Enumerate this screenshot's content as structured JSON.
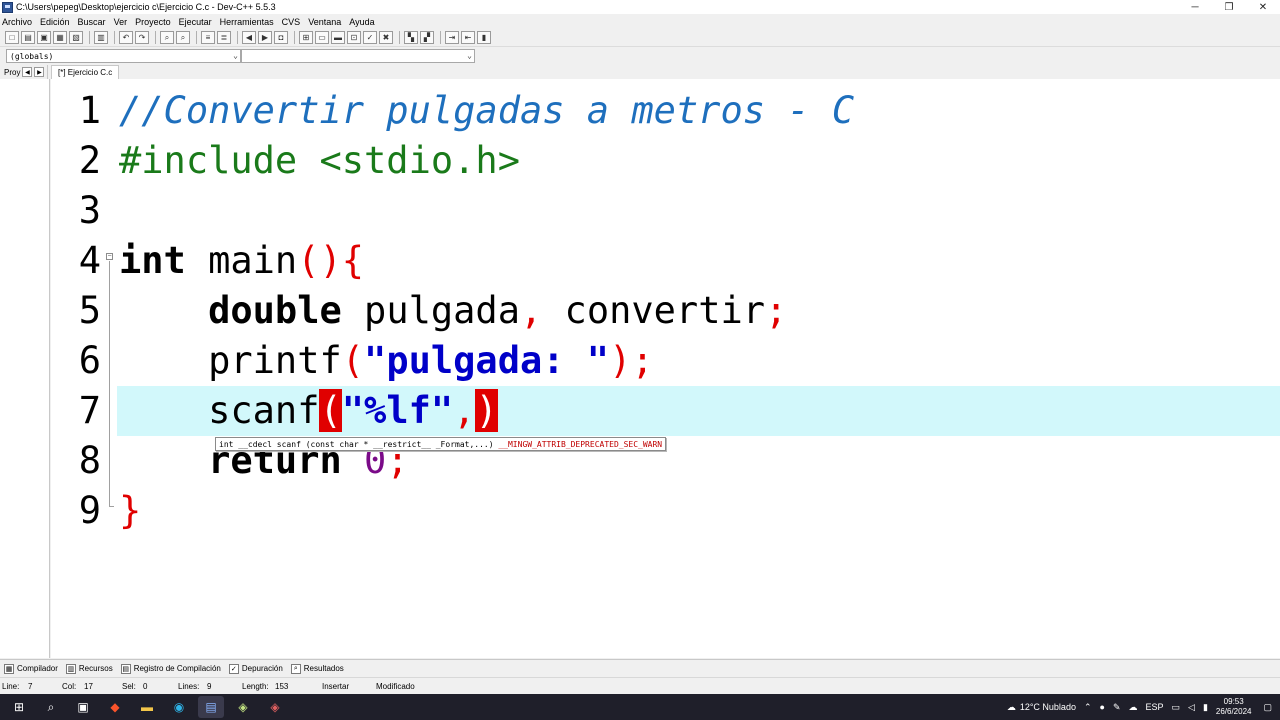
{
  "window": {
    "title": "C:\\Users\\pepeg\\Desktop\\ejercicio c\\Ejercicio C.c - Dev-C++ 5.5.3",
    "min_glyph": "─",
    "restore_glyph": "❐",
    "close_glyph": "✕"
  },
  "menu": [
    "Archivo",
    "Edición",
    "Buscar",
    "Ver",
    "Proyecto",
    "Ejecutar",
    "Herramientas",
    "CVS",
    "Ventana",
    "Ayuda"
  ],
  "scope_combo": {
    "value": "(globals)"
  },
  "member_combo": {
    "value": ""
  },
  "project_tab": {
    "label": "Proy"
  },
  "file_tab": {
    "label": "[*] Ejercicio C.c"
  },
  "editor": {
    "line_numbers": [
      "1",
      "2",
      "3",
      "4",
      "5",
      "6",
      "7",
      "8",
      "9"
    ],
    "current_line": 7,
    "lines": [
      [
        {
          "t": "//Convertir pulgadas a metros - C",
          "c": "cmt"
        }
      ],
      [
        {
          "t": "#include <stdio.h>",
          "c": "pp"
        }
      ],
      [],
      [
        {
          "t": "int",
          "c": "kw"
        },
        {
          "t": " main",
          "c": "id"
        },
        {
          "t": "(){",
          "c": "sym"
        }
      ],
      [
        {
          "t": "    ",
          "c": "id"
        },
        {
          "t": "double",
          "c": "kw"
        },
        {
          "t": " pulgada",
          "c": "id"
        },
        {
          "t": ",",
          "c": "sym"
        },
        {
          "t": " convertir",
          "c": "id"
        },
        {
          "t": ";",
          "c": "sym"
        }
      ],
      [
        {
          "t": "    printf",
          "c": "id"
        },
        {
          "t": "(",
          "c": "sym"
        },
        {
          "t": "\"pulgada: \"",
          "c": "str"
        },
        {
          "t": ");",
          "c": "sym"
        }
      ],
      [
        {
          "t": "    scanf",
          "c": "id"
        },
        {
          "t": "(",
          "c": "brhl"
        },
        {
          "t": "\"%lf\"",
          "c": "str"
        },
        {
          "t": ",",
          "c": "sym"
        },
        {
          "t": ")",
          "c": "brhl"
        }
      ],
      [
        {
          "t": "    ",
          "c": "id"
        },
        {
          "t": "return",
          "c": "kw"
        },
        {
          "t": " ",
          "c": "id"
        },
        {
          "t": "0",
          "c": "num"
        },
        {
          "t": ";",
          "c": "sym"
        }
      ],
      [
        {
          "t": "}",
          "c": "sym"
        }
      ]
    ]
  },
  "tooltip": {
    "signature": "int __cdecl scanf (const char * __restrict__ _Format,...) ",
    "attribute": "__MINGW_ATTRIB_DEPRECATED_SEC_WARN"
  },
  "bottom_tabs": [
    "Compilador",
    "Recursos",
    "Registro de Compilación",
    "Depuración",
    "Resultados"
  ],
  "status": {
    "line_label": "Line:",
    "line_value": "7",
    "col_label": "Col:",
    "col_value": "17",
    "sel_label": "Sel:",
    "sel_value": "0",
    "lines_label": "Lines:",
    "lines_value": "9",
    "length_label": "Length:",
    "length_value": "153",
    "mode": "Insertar",
    "modified": "Modificado"
  },
  "taskbar": {
    "weather": "12°C  Nublado",
    "lang": "ESP",
    "time": "09:53",
    "date": "26/6/2024"
  },
  "colors": {
    "comment": "#1e6fbd",
    "preprocessor": "#1a7a1a",
    "symbol": "#e00000",
    "string": "#0000c8",
    "number": "#7a0a88",
    "current_line": "#d2f8fb"
  }
}
